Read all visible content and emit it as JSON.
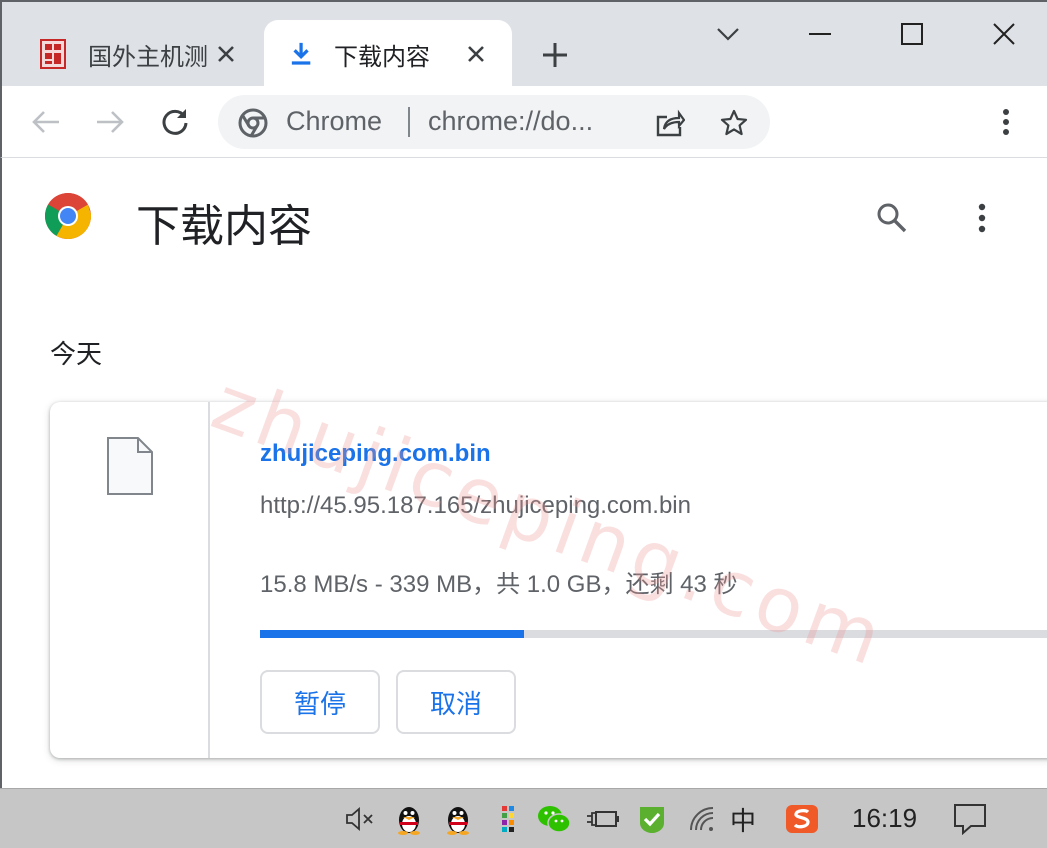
{
  "tabs": [
    {
      "title": "国外主机测",
      "favicon": "site-favicon",
      "active": false
    },
    {
      "title": "下载内容",
      "favicon": "download-icon",
      "active": true
    }
  ],
  "omnibox": {
    "chip": "Chrome",
    "url": "chrome://do..."
  },
  "page": {
    "title": "下载内容",
    "section_date": "今天",
    "watermark": "zhujiceping.com"
  },
  "download": {
    "file_name": "zhujiceping.com.bin",
    "url": "http://45.95.187.165/zhujiceping.com.bin",
    "status": "15.8 MB/s - 339 MB，共 1.0 GB，还剩 43 秒",
    "progress": 0.33,
    "pause_label": "暂停",
    "cancel_label": "取消"
  },
  "taskbar": {
    "ime": "中",
    "clock": "16:19"
  },
  "colors": {
    "accent": "#1a73e8",
    "tabstrip": "#dee1e6",
    "taskbar": "#c6c6c6"
  }
}
